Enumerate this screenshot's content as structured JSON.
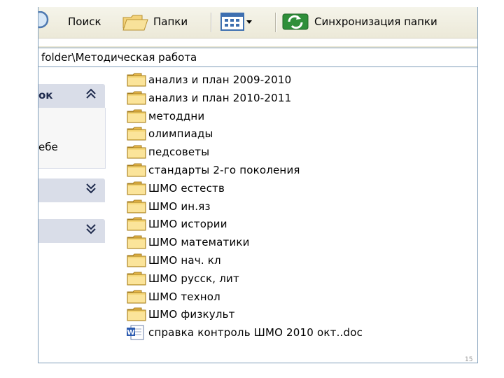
{
  "toolbar": {
    "search_label": "Поиск",
    "folders_label": "Папки",
    "sync_label": "Синхронизация папки"
  },
  "address": {
    "path": "folder\\Методическая работа"
  },
  "taskpane": {
    "panel1_title": "ок",
    "panel1_text": "ебе"
  },
  "files": [
    {
      "name": "анализ и план 2009-2010",
      "type": "folder"
    },
    {
      "name": "анализ и план 2010-2011",
      "type": "folder"
    },
    {
      "name": "методдни",
      "type": "folder"
    },
    {
      "name": "олимпиады",
      "type": "folder"
    },
    {
      "name": "педсоветы",
      "type": "folder"
    },
    {
      "name": "стандарты 2-го поколения",
      "type": "folder"
    },
    {
      "name": "ШМО естеств",
      "type": "folder"
    },
    {
      "name": "ШМО ин.яз",
      "type": "folder"
    },
    {
      "name": "ШМО истории",
      "type": "folder"
    },
    {
      "name": "ШМО математики",
      "type": "folder"
    },
    {
      "name": "ШМО нач. кл",
      "type": "folder"
    },
    {
      "name": "ШМО русск, лит",
      "type": "folder"
    },
    {
      "name": "ШМО технол",
      "type": "folder"
    },
    {
      "name": "ШМО физкульт",
      "type": "folder"
    },
    {
      "name": "справка контроль ШМО 2010 окт..doc",
      "type": "doc"
    }
  ],
  "page_number": "15"
}
